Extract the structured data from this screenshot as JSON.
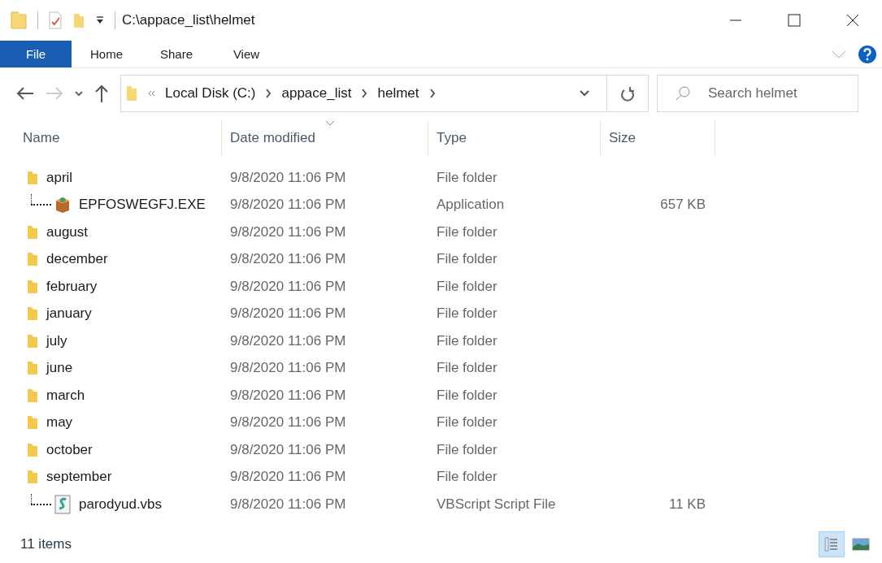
{
  "window": {
    "title": "C:\\appace_list\\helmet"
  },
  "ribbon_tabs": [
    {
      "label": "File",
      "selected": true
    },
    {
      "label": "Home",
      "selected": false
    },
    {
      "label": "Share",
      "selected": false
    },
    {
      "label": "View",
      "selected": false
    }
  ],
  "breadcrumb": [
    {
      "label": "Local Disk (C:)"
    },
    {
      "label": "appace_list"
    },
    {
      "label": "helmet"
    }
  ],
  "search": {
    "placeholder": "Search helmet"
  },
  "columns": [
    {
      "label": "Name",
      "sorted": false
    },
    {
      "label": "Date modified",
      "sorted": true
    },
    {
      "label": "Type",
      "sorted": false
    },
    {
      "label": "Size",
      "sorted": false
    }
  ],
  "rows": [
    {
      "kind": "folder",
      "name": "april",
      "date": "9/8/2020 11:06 PM",
      "type": "File folder",
      "size": "",
      "children": [
        {
          "kind": "application",
          "name": "EPFOSWEGFJ.EXE",
          "date": "9/8/2020 11:06 PM",
          "type": "Application",
          "size": "657 KB"
        }
      ]
    },
    {
      "kind": "folder",
      "name": "august",
      "date": "9/8/2020 11:06 PM",
      "type": "File folder",
      "size": ""
    },
    {
      "kind": "folder",
      "name": "december",
      "date": "9/8/2020 11:06 PM",
      "type": "File folder",
      "size": ""
    },
    {
      "kind": "folder",
      "name": "february",
      "date": "9/8/2020 11:06 PM",
      "type": "File folder",
      "size": ""
    },
    {
      "kind": "folder",
      "name": "january",
      "date": "9/8/2020 11:06 PM",
      "type": "File folder",
      "size": ""
    },
    {
      "kind": "folder",
      "name": "july",
      "date": "9/8/2020 11:06 PM",
      "type": "File folder",
      "size": ""
    },
    {
      "kind": "folder",
      "name": "june",
      "date": "9/8/2020 11:06 PM",
      "type": "File folder",
      "size": ""
    },
    {
      "kind": "folder",
      "name": "march",
      "date": "9/8/2020 11:06 PM",
      "type": "File folder",
      "size": ""
    },
    {
      "kind": "folder",
      "name": "may",
      "date": "9/8/2020 11:06 PM",
      "type": "File folder",
      "size": ""
    },
    {
      "kind": "folder",
      "name": "october",
      "date": "9/8/2020 11:06 PM",
      "type": "File folder",
      "size": ""
    },
    {
      "kind": "folder",
      "name": "september",
      "date": "9/8/2020 11:06 PM",
      "type": "File folder",
      "size": "",
      "children": [
        {
          "kind": "script",
          "name": "parodyud.vbs",
          "date": "9/8/2020 11:06 PM",
          "type": "VBScript Script File",
          "size": "11 KB"
        }
      ]
    }
  ],
  "status_bar": {
    "item_count": "11 items"
  },
  "view_buttons": [
    {
      "kind": "details",
      "selected": true
    },
    {
      "kind": "large-icons",
      "selected": false
    }
  ]
}
